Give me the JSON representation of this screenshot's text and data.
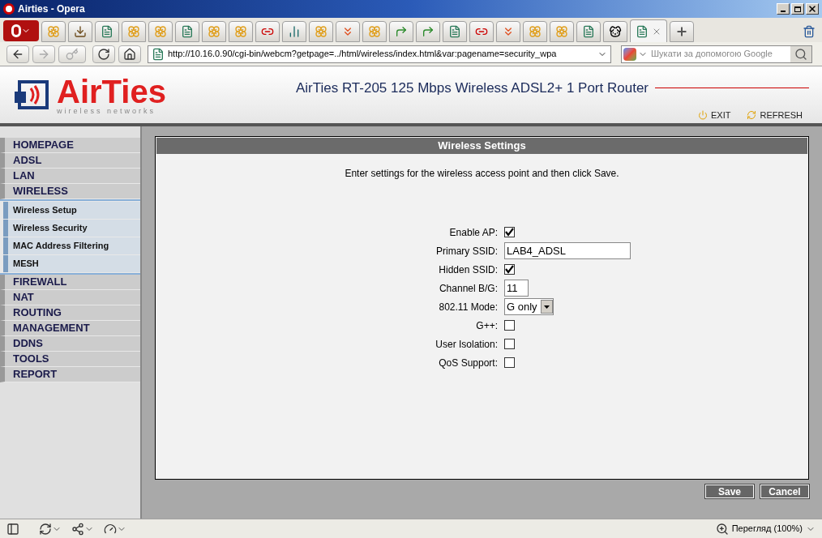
{
  "window": {
    "title": "Airties - Opera"
  },
  "tabs": [
    {
      "kind": "flower",
      "selected": false
    },
    {
      "kind": "download",
      "selected": false
    },
    {
      "kind": "page",
      "selected": false
    },
    {
      "kind": "flower",
      "selected": false
    },
    {
      "kind": "flower",
      "selected": false
    },
    {
      "kind": "page",
      "selected": false
    },
    {
      "kind": "flower",
      "selected": false
    },
    {
      "kind": "flower",
      "selected": false
    },
    {
      "kind": "link",
      "selected": false
    },
    {
      "kind": "chart",
      "selected": false
    },
    {
      "kind": "flower",
      "selected": false
    },
    {
      "kind": "chevrons",
      "selected": false
    },
    {
      "kind": "flower",
      "selected": false
    },
    {
      "kind": "arrow",
      "selected": false
    },
    {
      "kind": "arrow",
      "selected": false
    },
    {
      "kind": "page",
      "selected": false
    },
    {
      "kind": "link",
      "selected": false
    },
    {
      "kind": "chevrons",
      "selected": false
    },
    {
      "kind": "flower",
      "selected": false
    },
    {
      "kind": "flower",
      "selected": false
    },
    {
      "kind": "page",
      "selected": false
    },
    {
      "kind": "dog",
      "selected": false
    },
    {
      "kind": "page",
      "selected": true
    }
  ],
  "address_bar": {
    "url": "http://10.16.0.90/cgi-bin/webcm?getpage=../html/wireless/index.html&var:pagename=security_wpa"
  },
  "search": {
    "placeholder": "Шукати за допомогою Google"
  },
  "header": {
    "logo": "AirTies",
    "logo_tagline": "wireless networks",
    "title": "AirTies RT-205 125 Mbps Wireless ADSL2+ 1 Port Router",
    "links": [
      "EXIT",
      "REFRESH"
    ]
  },
  "sidebar": {
    "items": [
      {
        "label": "HOMEPAGE"
      },
      {
        "label": "ADSL"
      },
      {
        "label": "LAN"
      },
      {
        "label": "WIRELESS",
        "children": [
          {
            "label": "Wireless Setup"
          },
          {
            "label": "Wireless Security"
          },
          {
            "label": "MAC Address Filtering"
          },
          {
            "label": "MESH"
          }
        ]
      },
      {
        "label": "FIREWALL"
      },
      {
        "label": "NAT"
      },
      {
        "label": "ROUTING"
      },
      {
        "label": "MANAGEMENT"
      },
      {
        "label": "DDNS"
      },
      {
        "label": "TOOLS"
      },
      {
        "label": "REPORT"
      }
    ]
  },
  "panel": {
    "title": "Wireless Settings",
    "intro": "Enter settings for the wireless access point and then click Save.",
    "fields": [
      {
        "kind": "checkbox",
        "label": "Enable AP:",
        "checked": true
      },
      {
        "kind": "text",
        "label": "Primary SSID:",
        "value": "LAB4_ADSL"
      },
      {
        "kind": "checkbox",
        "label": "Hidden SSID:",
        "checked": true
      },
      {
        "kind": "text",
        "label": "Channel B/G:",
        "value": "11"
      },
      {
        "kind": "select",
        "label": "802.11 Mode:",
        "value": "G only"
      },
      {
        "kind": "checkbox",
        "label": "G++:",
        "checked": false
      },
      {
        "kind": "checkbox",
        "label": "User Isolation:",
        "checked": false
      },
      {
        "kind": "checkbox",
        "label": "QoS Support:",
        "checked": false
      }
    ]
  },
  "buttons": [
    "Save",
    "Cancel"
  ],
  "status_bar": {
    "zoom": "Перегляд (100%)"
  }
}
